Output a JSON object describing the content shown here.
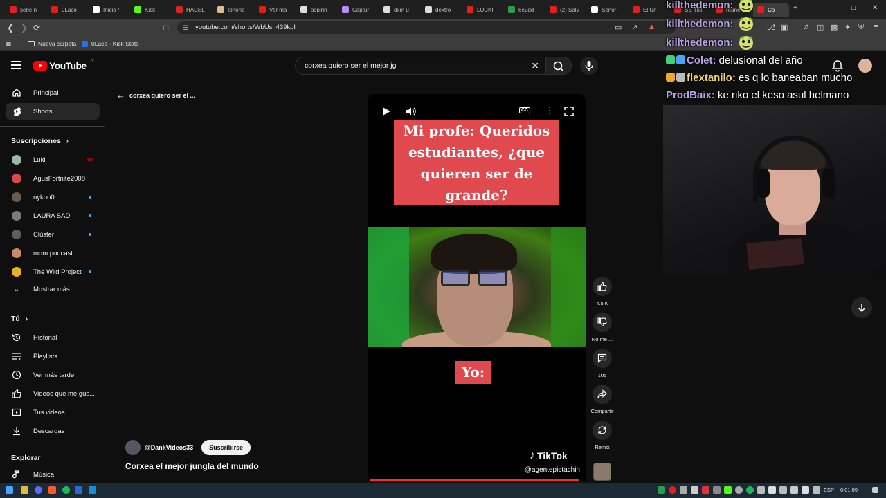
{
  "browser": {
    "tabs": [
      {
        "label": "serie n",
        "color": "#e02020"
      },
      {
        "label": "0Laco",
        "color": "#e02020"
      },
      {
        "label": "Inicio /",
        "color": "#ffffff"
      },
      {
        "label": "Kick",
        "color": "#53fc18"
      },
      {
        "label": "HACEL",
        "color": "#e02020"
      },
      {
        "label": "Iphone",
        "color": "#d6c08a"
      },
      {
        "label": "Ver má",
        "color": "#e02020"
      },
      {
        "label": "aspirin",
        "color": "#dddddd"
      },
      {
        "label": "Captur",
        "color": "#b88cff"
      },
      {
        "label": "dxm u",
        "color": "#dddddd"
      },
      {
        "label": "dextro",
        "color": "#dddddd"
      },
      {
        "label": "LUCKI",
        "color": "#e02020"
      },
      {
        "label": "6e2dd",
        "color": "#2a9d4a"
      },
      {
        "label": "(2) Salv",
        "color": "#e02020"
      },
      {
        "label": "Señor",
        "color": "#ffffff"
      },
      {
        "label": "El Uri",
        "color": "#e02020"
      },
      {
        "label": "SE TIR",
        "color": "#e02020"
      },
      {
        "label": "reane",
        "color": "#e02020"
      },
      {
        "label": "Co",
        "color": "#e02020"
      }
    ],
    "url": "youtube.com/shorts/WbUsn439kpl",
    "bookmarks": [
      "Nueva carpeta",
      "0Laco - Kick Stats"
    ]
  },
  "youtube": {
    "logo_text": "YouTube",
    "country_code": "UY",
    "search_value": "corxea quiero ser el mejor jg"
  },
  "sidebar": {
    "main": [
      {
        "label": "Principal",
        "icon": "home-icon"
      },
      {
        "label": "Shorts",
        "icon": "shorts-icon"
      }
    ],
    "subs_title": "Suscripciones",
    "subs": [
      {
        "label": "Luki",
        "color": "#9ab8a6",
        "marker": "live"
      },
      {
        "label": "AgusFortnite2008",
        "color": "#d84a4a",
        "marker": "none"
      },
      {
        "label": "nykoo0",
        "color": "#6b5a4a",
        "marker": "dot"
      },
      {
        "label": "LAURA SAD",
        "color": "#7a7a7a",
        "marker": "dot"
      },
      {
        "label": "Clúster",
        "color": "#5c5c5c",
        "marker": "dot"
      },
      {
        "label": "mom podcast",
        "color": "#c98a6a",
        "marker": "none"
      },
      {
        "label": "The Wild Project",
        "color": "#e3b324",
        "marker": "dot"
      }
    ],
    "show_more": "Mostrar más",
    "you_title": "Tú",
    "you": [
      {
        "label": "Historial",
        "icon": "history-icon"
      },
      {
        "label": "Playlists",
        "icon": "playlist-icon"
      },
      {
        "label": "Ver más tarde",
        "icon": "watch-later-icon"
      },
      {
        "label": "Videos que me gus...",
        "icon": "liked-icon"
      },
      {
        "label": "Tus videos",
        "icon": "your-videos-icon"
      },
      {
        "label": "Descargas",
        "icon": "download-icon"
      }
    ],
    "explore_title": "Explorar",
    "explore": [
      {
        "label": "Música",
        "icon": "music-icon"
      }
    ]
  },
  "shorts": {
    "back_label": "corxea quiero ser el ...",
    "caption_top": "Mi profe: Queridos estudiantes, ¿que quieren ser de grande?",
    "caption_bottom": "Yo:",
    "watermark": "TikTok",
    "watermark_handle": "@agentepistachin",
    "progress": 0.98,
    "likes": "4.5 K",
    "dislike_label": "No me ...",
    "comments": "105",
    "share_label": "Compartir",
    "remix_label": "Remix",
    "channel": "@DankVideos33",
    "subscribe_label": "Suscribirse",
    "title": "Corxea el mejor jungla del mundo"
  },
  "chat": [
    {
      "user": "killthedemon:",
      "text": "",
      "color": "#b9a3e8",
      "emote": true
    },
    {
      "user": "killthedemon:",
      "text": "",
      "color": "#b9a3e8",
      "emote": true
    },
    {
      "user": "killthedemon:",
      "text": "",
      "color": "#b9a3e8",
      "emote": true
    },
    {
      "user": "Colet:",
      "text": "delusional del año",
      "color": "#b9a3e8",
      "emote": false
    },
    {
      "user": "flextanilo:",
      "text": "es q lo baneaban mucho",
      "color": "#f5d76e",
      "emote": false
    },
    {
      "user": "ProdBaix:",
      "text": "ke riko el keso asul helmano",
      "color": "#b9a3e8",
      "emote": false
    }
  ],
  "taskbar": {
    "lang": "ESP",
    "time": "0:01:09"
  }
}
